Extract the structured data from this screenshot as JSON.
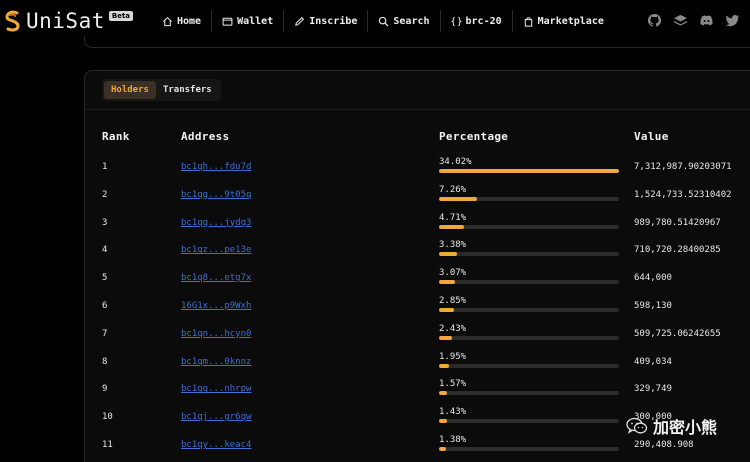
{
  "app": {
    "logo_text": "UniSat",
    "beta_badge": "Beta",
    "brand_color": "#f2a93b"
  },
  "nav": {
    "items": [
      {
        "label": "Home",
        "icon": "home-icon"
      },
      {
        "label": "Wallet",
        "icon": "wallet-icon"
      },
      {
        "label": "Inscribe",
        "icon": "pencil-icon"
      },
      {
        "label": "Search",
        "icon": "search-icon"
      },
      {
        "label": "brc-20",
        "icon": "braces-icon"
      },
      {
        "label": "Marketplace",
        "icon": "bag-icon"
      }
    ]
  },
  "social": [
    "github-icon",
    "layers-icon",
    "discord-icon",
    "twitter-icon"
  ],
  "tabs": {
    "holders": "Holders",
    "transfers": "Transfers",
    "active": "holders"
  },
  "table": {
    "headers": {
      "rank": "Rank",
      "address": "Address",
      "percentage": "Percentage",
      "value": "Value"
    },
    "rows": [
      {
        "rank": "1",
        "address": "bc1qh...fdu7d",
        "percentage": "34.02%",
        "value": "7,312,987.90203071",
        "pct": 34.02
      },
      {
        "rank": "2",
        "address": "bc1qg...9t05q",
        "percentage": "7.26%",
        "value": "1,524,733.52310402",
        "pct": 7.26
      },
      {
        "rank": "3",
        "address": "bc1qq...jydq3",
        "percentage": "4.71%",
        "value": "989,780.51420967",
        "pct": 4.71
      },
      {
        "rank": "4",
        "address": "bc1qz...pe13e",
        "percentage": "3.38%",
        "value": "710,720.28400285",
        "pct": 3.38
      },
      {
        "rank": "5",
        "address": "bc1q8...etg7x",
        "percentage": "3.07%",
        "value": "644,000",
        "pct": 3.07
      },
      {
        "rank": "6",
        "address": "16G1x...p9Wxh",
        "percentage": "2.85%",
        "value": "598,130",
        "pct": 2.85
      },
      {
        "rank": "7",
        "address": "bc1qn...hcyn0",
        "percentage": "2.43%",
        "value": "509,725.06242655",
        "pct": 2.43
      },
      {
        "rank": "8",
        "address": "bc1qm...0knnz",
        "percentage": "1.95%",
        "value": "409,034",
        "pct": 1.95
      },
      {
        "rank": "9",
        "address": "bc1qq...nhrpw",
        "percentage": "1.57%",
        "value": "329,749",
        "pct": 1.57
      },
      {
        "rank": "10",
        "address": "bc1qj...gr6qw",
        "percentage": "1.43%",
        "value": "300,000",
        "pct": 1.43
      },
      {
        "rank": "11",
        "address": "bc1qy...keac4",
        "percentage": "1.38%",
        "value": "290,408.908",
        "pct": 1.38
      }
    ]
  },
  "watermark": {
    "text": "加密小熊",
    "icon": "wechat-icon"
  }
}
